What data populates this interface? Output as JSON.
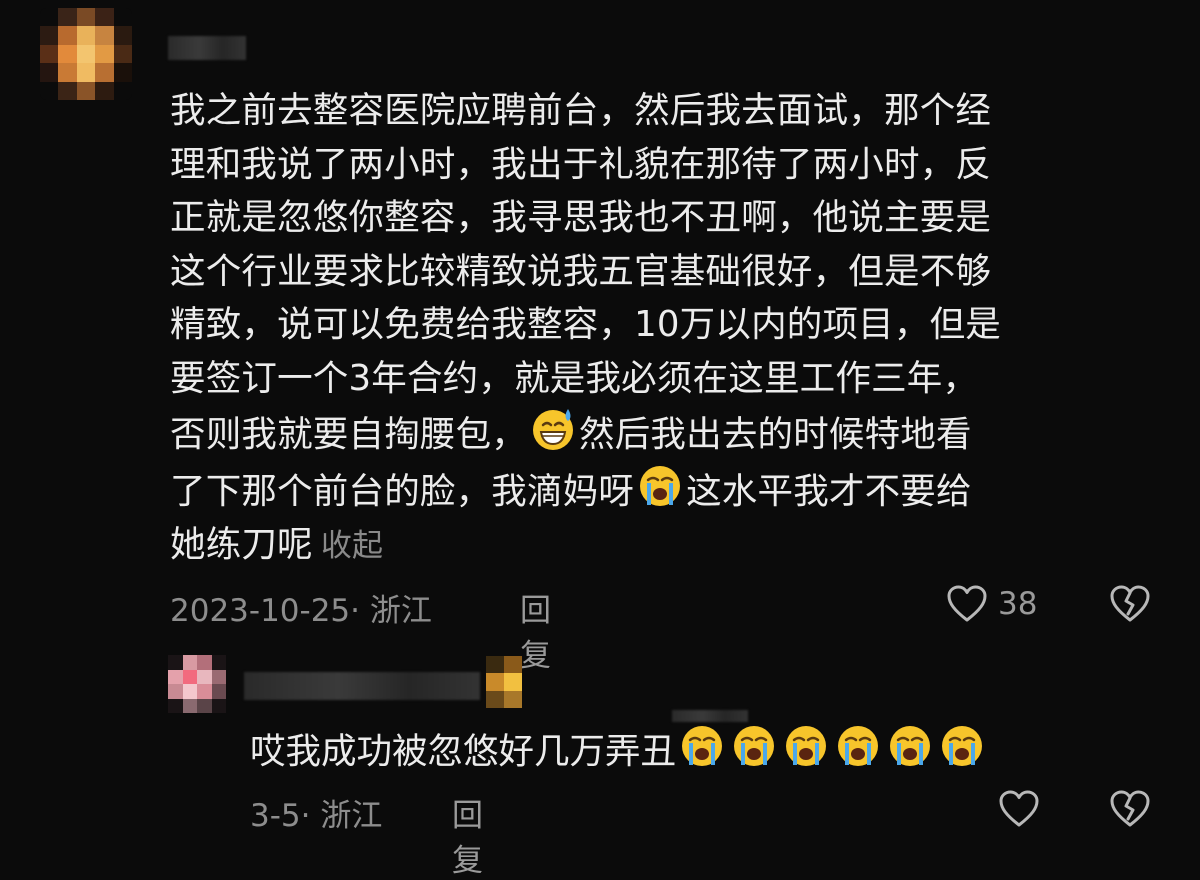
{
  "main_comment": {
    "avatar": "pixelated-avatar",
    "username_hidden": true,
    "lines": [
      "我之前去整容医院应聘前台，然后我去面试，那个经",
      "理和我说了两小时，我出于礼貌在那待了两小时，反",
      "正就是忽悠你整容，我寻思我也不丑啊，他说主要是",
      "这个行业要求比较精致说我五官基础很好，但是不够",
      "精致，说可以免费给我整容，10万以内的项目，但是",
      "要签订一个3年合约，就是我必须在这里工作三年，"
    ],
    "line7_before": "否则我就要自掏腰包，",
    "line7_emoji": "grinning-sweat-emoji",
    "line7_after": "然后我出去的时候特地看",
    "line8_before": "了下那个前台的脸，我滴妈呀",
    "line8_emoji": "loudly-crying-emoji",
    "line8_after": "这水平我才不要给",
    "line9": "她练刀呢",
    "collapse_label": "收起",
    "date_location": "2023-10-25· 浙江",
    "reply_label": "回复",
    "like_count": "38",
    "like_icon": "heart-outline-icon",
    "dislike_icon": "broken-heart-icon"
  },
  "reply_comment": {
    "avatar": "pixelated-avatar",
    "username_hidden": true,
    "text": "哎我成功被忽悠好几万弄丑",
    "emoji": "loudly-crying-emoji",
    "emoji_count": 6,
    "date_location": "3-5· 浙江",
    "reply_label": "回复",
    "like_icon": "heart-outline-icon",
    "dislike_icon": "broken-heart-icon"
  },
  "colors": {
    "background": "#0b0b0b",
    "text": "#ececec",
    "meta": "#8d8d8d",
    "emoji_face": "#f7c52b"
  }
}
